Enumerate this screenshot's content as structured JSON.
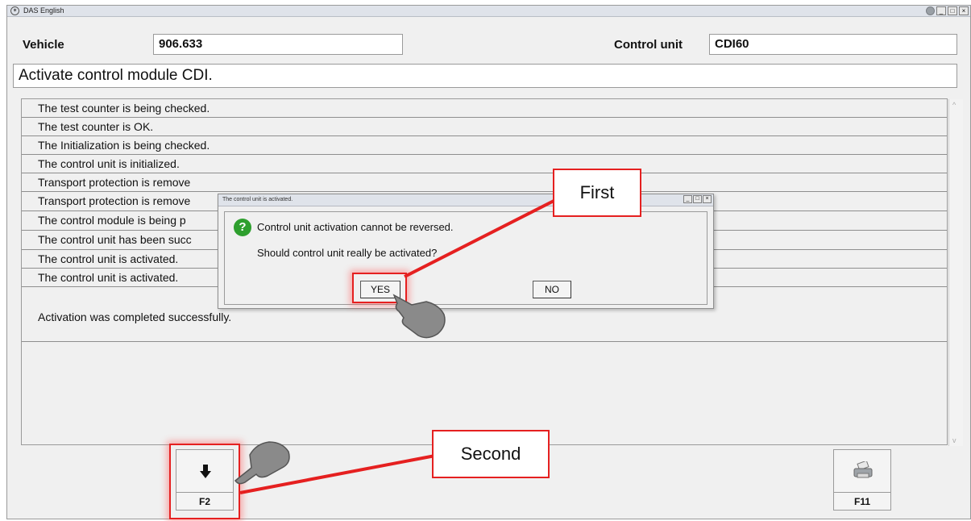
{
  "window": {
    "title": "DAS English",
    "controls": [
      "_",
      "□",
      "×"
    ]
  },
  "header": {
    "vehicle_label": "Vehicle",
    "vehicle_value": "906.633",
    "control_unit_label": "Control unit",
    "control_unit_value": "CDI60"
  },
  "instruction": "Activate control module CDI.",
  "log_rows": [
    "The test counter is being checked.",
    "The test counter is OK.",
    "The Initialization is being checked.",
    "The control unit is initialized.",
    "Transport protection is remove",
    "Transport protection is remove",
    "The control module is being p",
    "The control unit has been succ",
    "The control unit is activated.",
    "The control unit is activated.",
    "Activation was completed successfully."
  ],
  "dialog": {
    "title": "The control unit is activated.",
    "controls": [
      "_",
      "□",
      "×"
    ],
    "message_1": "Control unit activation cannot be reversed.",
    "message_2": "Should control unit really be activated?",
    "yes_label": "YES",
    "no_label": "NO",
    "icon": "question-icon"
  },
  "function_keys": {
    "f2_label": "F2",
    "f2_icon": "down-arrow-icon",
    "f11_label": "F11",
    "f11_icon": "printer-icon"
  },
  "annotations": {
    "first_label": "First",
    "second_label": "Second",
    "color": "#e52020"
  },
  "colors": {
    "background": "#f0f0f0",
    "titlebar": "#dfe3ea",
    "question_icon": "#2e9f2e"
  }
}
